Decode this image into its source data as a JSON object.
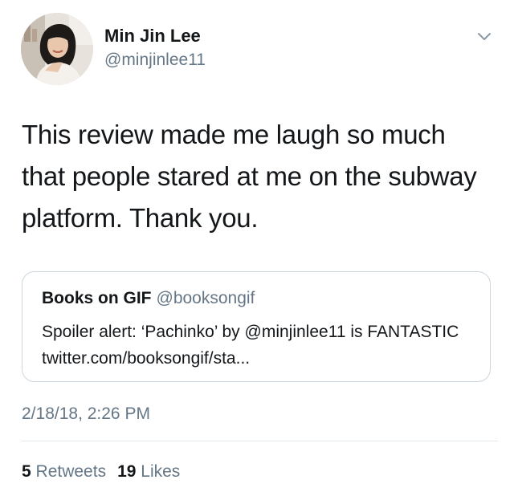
{
  "author": {
    "name": "Min Jin Lee",
    "handle": "@minjinlee11",
    "avatar_icon": "profile-photo"
  },
  "tweet": {
    "text": "This review made me laugh so much that people stared at me on the subway platform. Thank you.",
    "timestamp": "2/18/18, 2:26 PM"
  },
  "quoted_tweet": {
    "name": "Books on GIF",
    "handle": "@booksongif",
    "text": "Spoiler alert: ‘Pachinko’ by @minjinlee11 is FANTASTIC twitter.com/booksongif/sta..."
  },
  "stats": {
    "retweets_count": "5",
    "retweets_label": "Retweets",
    "likes_count": "19",
    "likes_label": "Likes"
  },
  "menu": {
    "icon": "chevron-down-icon"
  },
  "colors": {
    "primary_text": "#14171a",
    "secondary_text": "#657786",
    "border": "#ccd6dd",
    "divider": "#e1e8ed"
  }
}
